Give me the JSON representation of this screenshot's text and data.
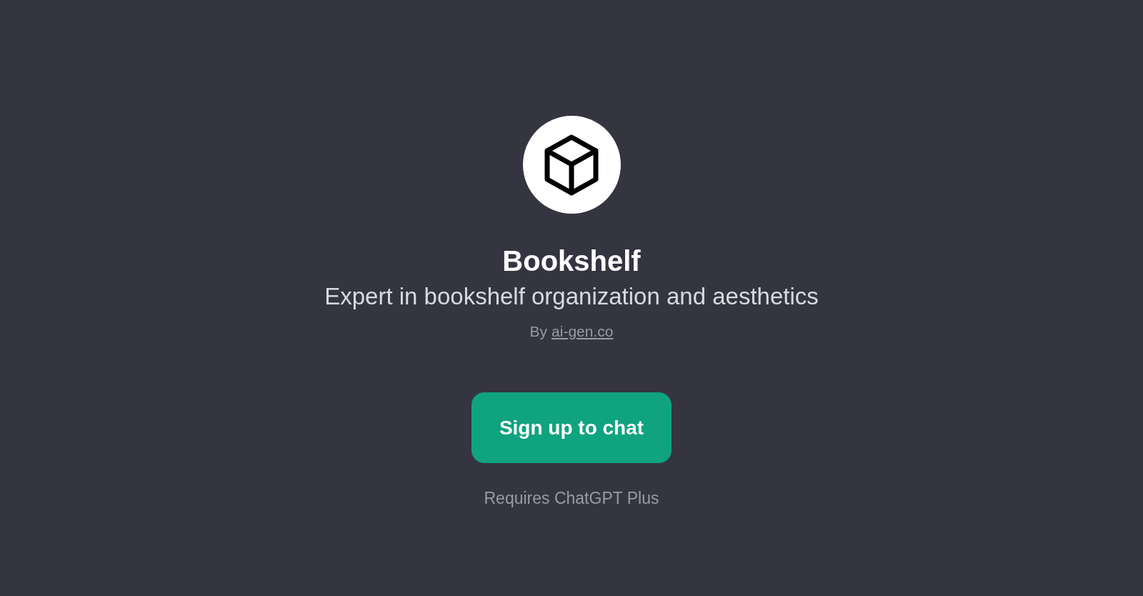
{
  "title": "Bookshelf",
  "description": "Expert in bookshelf organization and aesthetics",
  "author": {
    "prefix": "By",
    "link": "ai-gen.co"
  },
  "button": {
    "label": "Sign up to chat"
  },
  "note": "Requires ChatGPT Plus"
}
